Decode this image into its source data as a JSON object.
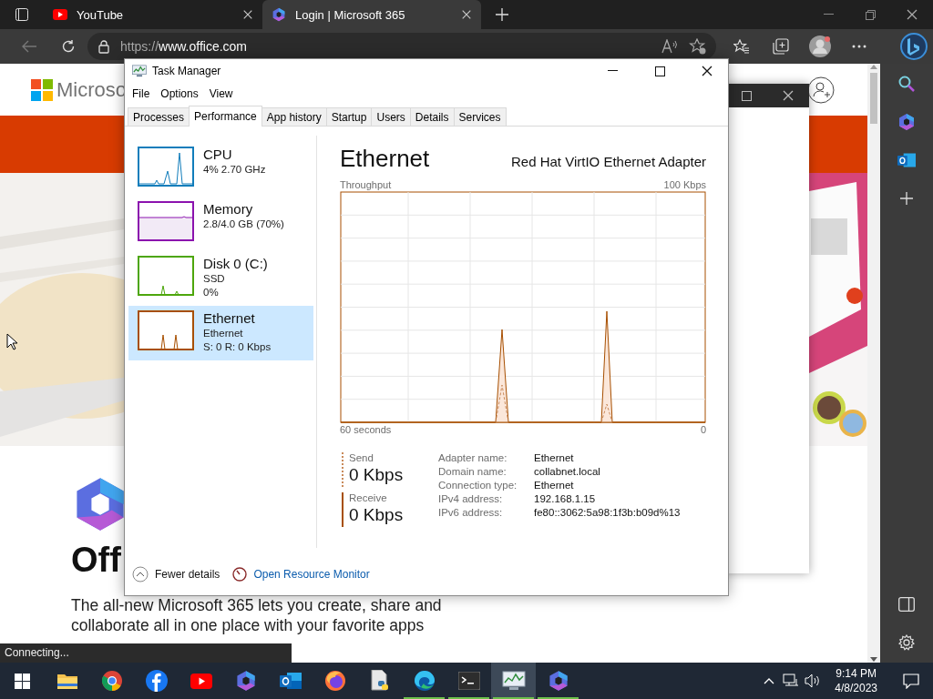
{
  "browser": {
    "tabs": [
      {
        "kind": "video",
        "title": "YouTube",
        "selected": false
      },
      {
        "kind": "office",
        "title": "Login | Microsoft 365",
        "selected": true
      }
    ],
    "address": {
      "scheme": "https://",
      "host": "www.office.com"
    }
  },
  "page": {
    "brand": "Microso",
    "heading": "Off",
    "intro": "The all-new Microsoft 365 lets you create, share and collaborate all in one place with your favorite apps",
    "status": "Connecting..."
  },
  "task_manager": {
    "title": "Task Manager",
    "menu": [
      "File",
      "Options",
      "View"
    ],
    "tabs": [
      {
        "label": "Processes",
        "selected": false
      },
      {
        "label": "Performance",
        "selected": true
      },
      {
        "label": "App history",
        "selected": false
      },
      {
        "label": "Startup",
        "selected": false
      },
      {
        "label": "Users",
        "selected": false
      },
      {
        "label": "Details",
        "selected": false
      },
      {
        "label": "Services",
        "selected": false
      }
    ],
    "resources": [
      {
        "kind": "cpu",
        "name": "CPU",
        "lines": [
          "4% 2.70 GHz"
        ],
        "color": "#117dbb",
        "selected": false
      },
      {
        "kind": "memory",
        "name": "Memory",
        "lines": [
          "2.8/4.0 GB (70%)"
        ],
        "color": "#8b12ae",
        "selected": false
      },
      {
        "kind": "disk",
        "name": "Disk 0 (C:)",
        "lines": [
          "SSD",
          "0%"
        ],
        "color": "#4da60c",
        "selected": false
      },
      {
        "kind": "network",
        "name": "Ethernet",
        "lines": [
          "Ethernet",
          "S: 0 R: 0 Kbps"
        ],
        "color": "#a74f01",
        "selected": true
      }
    ],
    "detail": {
      "title": "Ethernet",
      "adapter": "Red Hat VirtIO Ethernet Adapter",
      "graph": {
        "title": "Throughput",
        "max_label": "100 Kbps",
        "span_label": "60 seconds",
        "zero_label": "0"
      },
      "send": {
        "label": "Send",
        "value": "0 Kbps"
      },
      "receive": {
        "label": "Receive",
        "value": "0 Kbps"
      },
      "properties": [
        {
          "label": "Adapter name:",
          "value": "Ethernet"
        },
        {
          "label": "Domain name:",
          "value": "collabnet.local"
        },
        {
          "label": "Connection type:",
          "value": "Ethernet"
        },
        {
          "label": "IPv4 address:",
          "value": "192.168.1.15"
        },
        {
          "label": "IPv6 address:",
          "value": "fe80::3062:5a98:1f3b:b09d%13"
        }
      ]
    },
    "footer": {
      "toggle": "Fewer details",
      "link": "Open Resource Monitor"
    }
  },
  "taskbar": {
    "apps": [
      {
        "kind": "folder",
        "running": false,
        "selected": false
      },
      {
        "kind": "chrome",
        "running": false,
        "selected": false
      },
      {
        "kind": "social",
        "running": false,
        "selected": false
      },
      {
        "kind": "video",
        "running": false,
        "selected": false
      },
      {
        "kind": "office",
        "running": false,
        "selected": false
      },
      {
        "kind": "mail",
        "running": false,
        "selected": false
      },
      {
        "kind": "fox",
        "running": false,
        "selected": false
      },
      {
        "kind": "script",
        "running": false,
        "selected": false
      },
      {
        "kind": "edge",
        "running": true,
        "selected": false
      },
      {
        "kind": "terminal",
        "running": true,
        "selected": false
      },
      {
        "kind": "monitor",
        "running": true,
        "selected": true
      },
      {
        "kind": "office",
        "running": true,
        "selected": false
      }
    ],
    "time": "9:14 PM",
    "date": "4/8/2023"
  }
}
